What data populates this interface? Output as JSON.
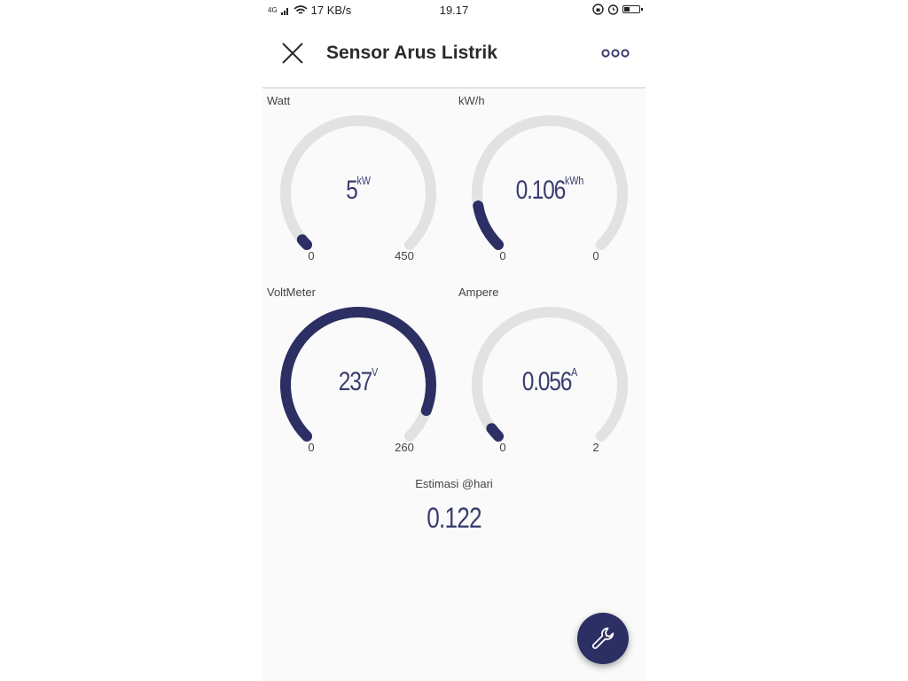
{
  "status_bar": {
    "network": "4G",
    "speed": "17 KB/s",
    "time": "19.17"
  },
  "header": {
    "title": "Sensor Arus Listrik",
    "close_icon": "close-icon",
    "more_icon": "more-options-icon"
  },
  "gauges": [
    {
      "label": "Watt",
      "value": "5",
      "unit": "kW",
      "min": "0",
      "max": "450",
      "fill_fraction": 0.02
    },
    {
      "label": "kW/h",
      "value": "0.106",
      "unit": "kWh",
      "min": "0",
      "max": "0",
      "fill_fraction": 0.13
    },
    {
      "label": "VoltMeter",
      "value": "237",
      "unit": "V",
      "min": "0",
      "max": "260",
      "fill_fraction": 0.91
    },
    {
      "label": "Ampere",
      "value": "0.056",
      "unit": "A",
      "min": "0",
      "max": "2",
      "fill_fraction": 0.03
    }
  ],
  "estimate": {
    "label": "Estimasi @hari",
    "value": "0.122"
  },
  "fab": {
    "icon": "wrench-icon"
  },
  "colors": {
    "accent": "#2c2f63",
    "track": "#e2e2e2",
    "value_text": "#3a3d6e"
  }
}
